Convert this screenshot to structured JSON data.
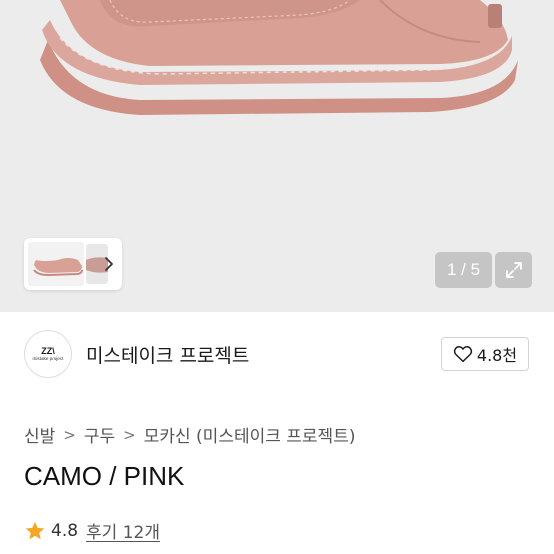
{
  "gallery": {
    "counter": "1 / 5",
    "current_index": 1,
    "total": 5
  },
  "store": {
    "logo_line1": "ZZ\\",
    "logo_line2": "mistake project",
    "name": "미스테이크 프로젝트",
    "likes": "4.8천"
  },
  "breadcrumb": [
    "신발",
    "구두",
    "모카신 (미스테이크 프로젝트)"
  ],
  "product": {
    "title": "CAMO / PINK",
    "rating": "4.8",
    "reviews": "후기 12개"
  },
  "colors": {
    "star": "#f5a623",
    "shoe": "#d9a096",
    "hero_bg": "#ececec"
  },
  "icons": {
    "like": "heart-outline-icon",
    "expand": "expand-diagonal-icon",
    "next": "chevron-right-icon",
    "rating": "star-icon"
  }
}
